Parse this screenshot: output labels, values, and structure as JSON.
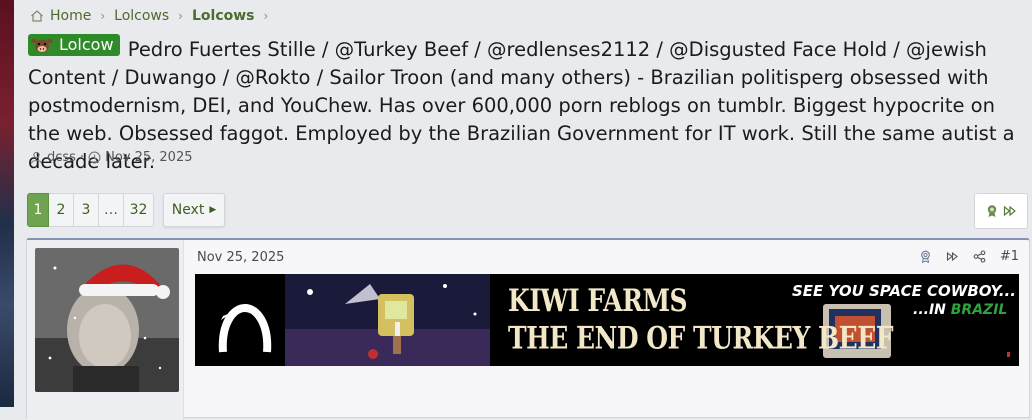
{
  "breadcrumb": {
    "items": [
      "Home",
      "Lolcows",
      "Lolcows"
    ]
  },
  "thread": {
    "prefix": "Lolcow",
    "title": "Pedro Fuertes Stille / @Turkey Beef / @redlenses2112 / @Disgusted Face Hold / @jewish Content / Duwango / @Rokto / Sailor Troon (and many others) - Brazilian politisperg obsessed with postmodernism, DEI, and YouChew. Has over 600,000 porn reblogs on tumblr. Biggest hypocrite on the web. Obsessed faggot. Employed by the Brazilian Government for IT work. Still the same autist a decade later.",
    "author": "dcss",
    "date": "Nov 25, 2025"
  },
  "pagination": {
    "pages": [
      "1",
      "2",
      "3",
      "…",
      "32"
    ],
    "current": "1",
    "next_label": "Next"
  },
  "post": {
    "date": "Nov 25, 2025",
    "number": "#1",
    "banner": {
      "title_line1": "KIWI FARMS",
      "title_line2": "THE END OF TURKEY BEEF",
      "tagline": "SEE YOU SPACE COWBOY...",
      "tagline2_prefix": "...IN ",
      "tagline2_word": "BRAZIL"
    }
  },
  "colors": {
    "accent_green": "#4d6b2d",
    "prefix_bg": "#2f8a2a",
    "page_current": "#6fa350",
    "post_border": "#8393b5"
  }
}
